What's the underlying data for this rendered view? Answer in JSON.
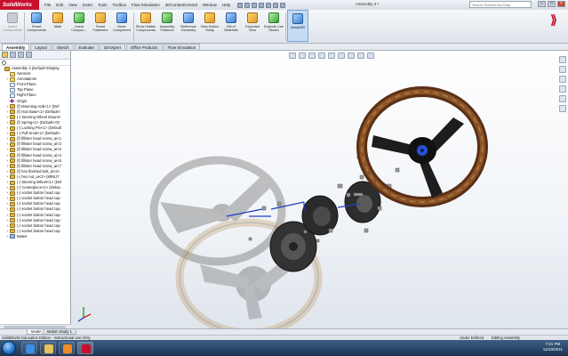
{
  "app": {
    "logo": "SolidWorks",
    "window_title": "Assembly 3 *",
    "search_placeholder": "Search SolidWorks Help"
  },
  "menu": [
    "File",
    "Edit",
    "View",
    "Insert",
    "Tools",
    "Toolbox",
    "Flow Simulation",
    "3DContentCentral",
    "Window",
    "Help"
  ],
  "commands": [
    {
      "label": "Insert Components",
      "name": "insert-components-button",
      "style": "disabled"
    },
    {
      "label": "Smart Components",
      "name": "smart-components-button",
      "style": "blue"
    },
    {
      "label": "Mate",
      "name": "mate-button",
      "style": ""
    },
    {
      "label": "Linear Compon...",
      "name": "linear-component-pattern-button",
      "style": "green"
    },
    {
      "label": "Smart Fasteners",
      "name": "smart-fasteners-button",
      "style": ""
    },
    {
      "label": "Move Component",
      "name": "move-component-button",
      "style": "blue"
    },
    {
      "label": "Show Hidden Components",
      "name": "show-hidden-components-button",
      "style": ""
    },
    {
      "label": "Assembly Features",
      "name": "assembly-features-button",
      "style": "green"
    },
    {
      "label": "Reference Geometry",
      "name": "reference-geometry-button",
      "style": "blue"
    },
    {
      "label": "New Motion Study",
      "name": "new-motion-study-button",
      "style": ""
    },
    {
      "label": "Bill of Materials",
      "name": "bill-of-materials-button",
      "style": "blue"
    },
    {
      "label": "Exploded View",
      "name": "exploded-view-button",
      "style": ""
    },
    {
      "label": "Explode Line Sketch",
      "name": "explode-line-sketch-button",
      "style": "green"
    },
    {
      "label": "Instant3D",
      "name": "instant3d-button",
      "style": "blue active"
    }
  ],
  "tabs": [
    "Assembly",
    "Layout",
    "Sketch",
    "Evaluate",
    "DimXpert",
    "Office Products",
    "Flow Simulation"
  ],
  "tree": [
    {
      "text": "Assembly 3 (Default<Display",
      "icon": "assembly",
      "level": 0,
      "exp": ""
    },
    {
      "text": "Sensors",
      "icon": "folder",
      "level": 1,
      "exp": ""
    },
    {
      "text": "Annotations",
      "icon": "folder",
      "level": 1,
      "exp": "+"
    },
    {
      "text": "Front Plane",
      "icon": "plane",
      "level": 1,
      "exp": ""
    },
    {
      "text": "Top Plane",
      "icon": "plane",
      "level": 1,
      "exp": ""
    },
    {
      "text": "Right Plane",
      "icon": "plane",
      "level": 1,
      "exp": ""
    },
    {
      "text": "Origin",
      "icon": "origin",
      "level": 1,
      "exp": ""
    },
    {
      "text": "(f) Mounting Hub<1> (Def",
      "icon": "part",
      "level": 1,
      "exp": "+"
    },
    {
      "text": "(f) Hub Base<1> (Default<",
      "icon": "part",
      "level": 1,
      "exp": "+"
    },
    {
      "text": "(-) Steering Wheel Mount<",
      "icon": "part",
      "level": 1,
      "exp": "+"
    },
    {
      "text": "(f) Spring<1> (Default<<D",
      "icon": "part",
      "level": 1,
      "exp": "+"
    },
    {
      "text": "(-) Locking Pin<1> (Default",
      "icon": "part",
      "level": 1,
      "exp": "+"
    },
    {
      "text": "(-) Pull Knob<1> (Default<",
      "icon": "part",
      "level": 1,
      "exp": "+"
    },
    {
      "text": "(f) fillister head screw_ai<1",
      "icon": "part",
      "level": 1,
      "exp": "+"
    },
    {
      "text": "(f) fillister head screw_ai<2",
      "icon": "part",
      "level": 1,
      "exp": "+"
    },
    {
      "text": "(f) fillister head screw_ai<3",
      "icon": "part",
      "level": 1,
      "exp": "+"
    },
    {
      "text": "(f) fillister head screw_ai<4",
      "icon": "part",
      "level": 1,
      "exp": "+"
    },
    {
      "text": "(f) fillister head screw_ai<5",
      "icon": "part",
      "level": 1,
      "exp": "+"
    },
    {
      "text": "(f) fillister head screw_ai<7",
      "icon": "part",
      "level": 1,
      "exp": "+"
    },
    {
      "text": "(f) hex finished bolt_ai<2>",
      "icon": "part",
      "level": 1,
      "exp": "+"
    },
    {
      "text": "(-) hex nut_ai<2> (MINUT",
      "icon": "part",
      "level": 1,
      "exp": "+"
    },
    {
      "text": "(-) Steering Wheel<1> (Def",
      "icon": "part",
      "level": 1,
      "exp": "+"
    },
    {
      "text": "(-) Centerpiece<1> (Defau",
      "icon": "part",
      "level": 1,
      "exp": "+"
    },
    {
      "text": "(-) socket button head cap",
      "icon": "part",
      "level": 1,
      "exp": "+"
    },
    {
      "text": "(-) socket button head cap",
      "icon": "part",
      "level": 1,
      "exp": "+"
    },
    {
      "text": "(-) socket button head cap",
      "icon": "part",
      "level": 1,
      "exp": "+"
    },
    {
      "text": "(-) socket button head cap",
      "icon": "part",
      "level": 1,
      "exp": "+"
    },
    {
      "text": "(-) socket button head cap",
      "icon": "part",
      "level": 1,
      "exp": "+"
    },
    {
      "text": "(-) socket button head cap",
      "icon": "part",
      "level": 1,
      "exp": "+"
    },
    {
      "text": "(-) socket button head cap",
      "icon": "part",
      "level": 1,
      "exp": "+"
    },
    {
      "text": "(-) socket button head cap",
      "icon": "part",
      "level": 1,
      "exp": "+"
    },
    {
      "text": "Mates",
      "icon": "mates",
      "level": 1,
      "exp": "+"
    }
  ],
  "bottom_tabs": {
    "model": "Model",
    "motion": "Motion Study 1"
  },
  "status": {
    "left": "SolidWorks Education Edition - Instructional Use Only",
    "state": "Under Defined",
    "mode": "Editing Assembly"
  },
  "clock": {
    "time": "7:21 PM",
    "date": "12/10/2011"
  },
  "colors": {
    "accent": "#c8102e",
    "wood": "#6b3a1f",
    "taskbar": "#1c3451"
  }
}
